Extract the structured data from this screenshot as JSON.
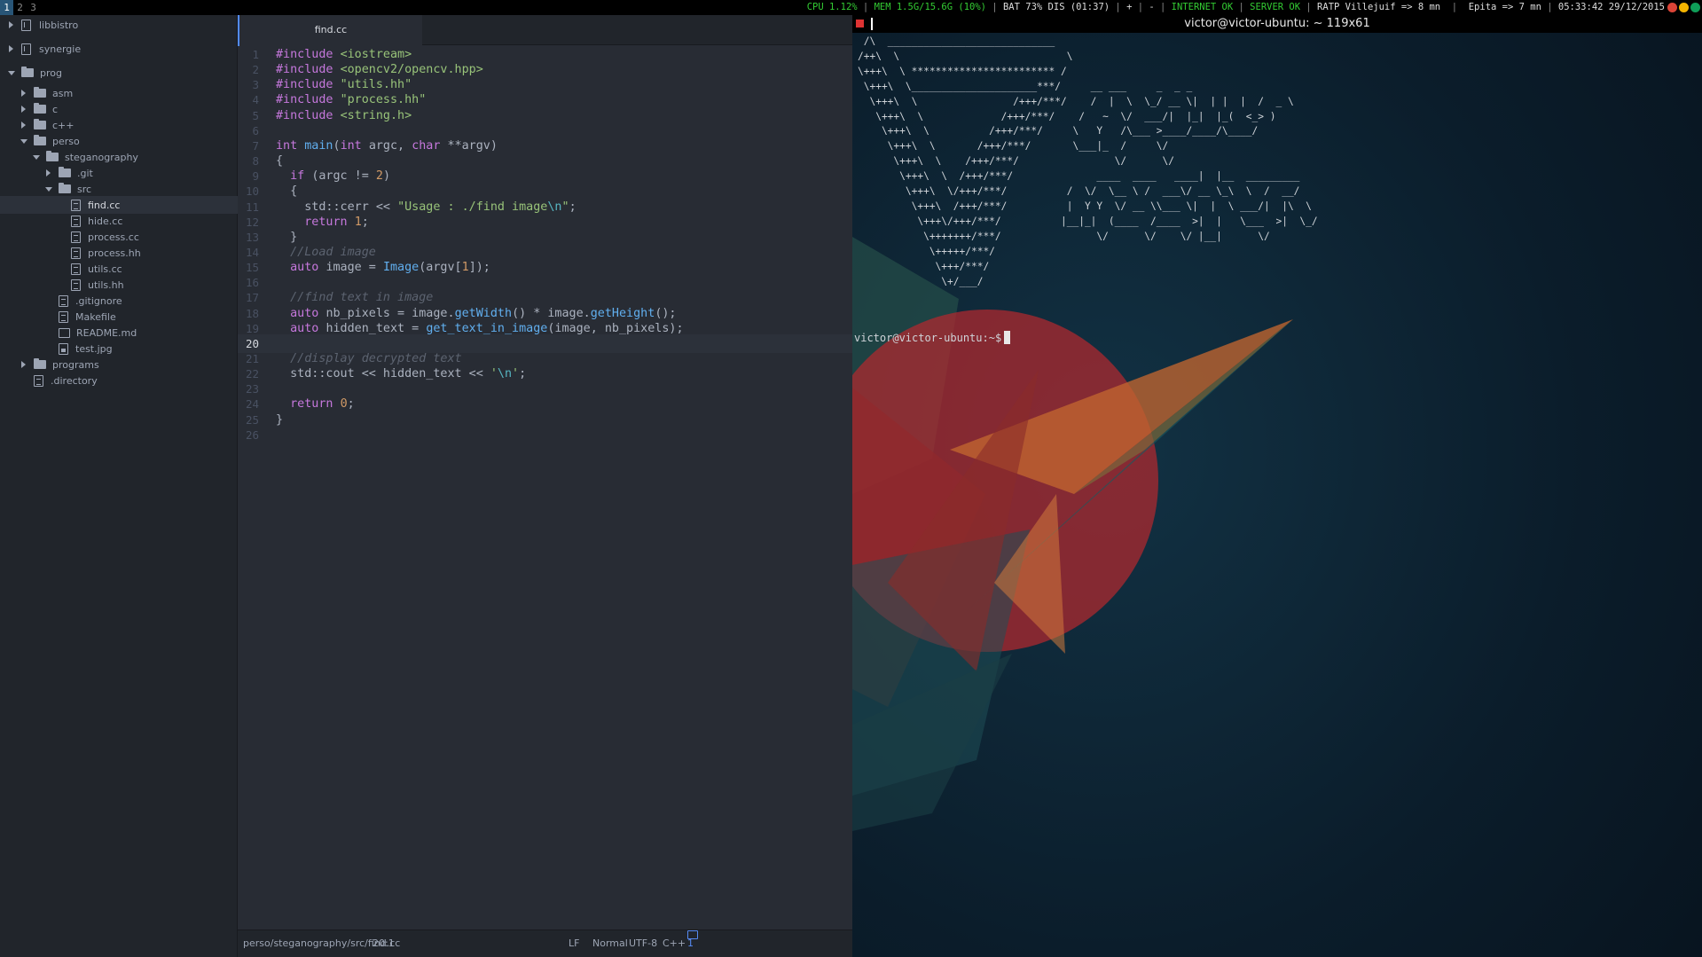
{
  "topbar": {
    "workspaces": [
      "1",
      "2",
      "3"
    ],
    "active_workspace": "1",
    "cpu": "CPU 1.12%",
    "mem": "MEM 1.5G/15.6G (10%)",
    "battery": "BAT 73% DIS (01:37)",
    "plus": "+",
    "dash": "-",
    "internet": "INTERNET OK",
    "server": "SERVER OK",
    "ratp": "RATP Villejuif => 8 mn",
    "epita": "Epita => 7 mn",
    "datetime": "05:33:42 29/12/2015"
  },
  "tree": [
    {
      "label": "libbistro",
      "icon": "repo-icon",
      "chevron": "right",
      "depth": 0
    },
    {
      "label": "synergie",
      "icon": "repo-icon",
      "chevron": "right",
      "depth": 0
    },
    {
      "label": "prog",
      "icon": "folder-icon",
      "chevron": "down",
      "depth": 0
    },
    {
      "label": "asm",
      "icon": "folder-icon",
      "chevron": "right",
      "depth": 1
    },
    {
      "label": "c",
      "icon": "folder-icon",
      "chevron": "right",
      "depth": 1
    },
    {
      "label": "c++",
      "icon": "folder-icon",
      "chevron": "right",
      "depth": 1
    },
    {
      "label": "perso",
      "icon": "folder-icon",
      "chevron": "down",
      "depth": 1
    },
    {
      "label": "steganography",
      "icon": "folder-icon",
      "chevron": "down",
      "depth": 2
    },
    {
      "label": ".git",
      "icon": "folder-icon",
      "chevron": "right",
      "depth": 3
    },
    {
      "label": "src",
      "icon": "folder-icon",
      "chevron": "down",
      "depth": 3
    },
    {
      "label": "find.cc",
      "icon": "file-icon",
      "chevron": "none",
      "depth": 4,
      "selected": true
    },
    {
      "label": "hide.cc",
      "icon": "file-icon",
      "chevron": "none",
      "depth": 4
    },
    {
      "label": "process.cc",
      "icon": "file-icon",
      "chevron": "none",
      "depth": 4
    },
    {
      "label": "process.hh",
      "icon": "file-icon",
      "chevron": "none",
      "depth": 4
    },
    {
      "label": "utils.cc",
      "icon": "file-icon",
      "chevron": "none",
      "depth": 4
    },
    {
      "label": "utils.hh",
      "icon": "file-icon",
      "chevron": "none",
      "depth": 4
    },
    {
      "label": ".gitignore",
      "icon": "file-icon",
      "chevron": "none",
      "depth": 3
    },
    {
      "label": "Makefile",
      "icon": "file-icon",
      "chevron": "none",
      "depth": 3
    },
    {
      "label": "README.md",
      "icon": "markdown-icon",
      "chevron": "none",
      "depth": 3
    },
    {
      "label": "test.jpg",
      "icon": "image-icon",
      "chevron": "none",
      "depth": 3
    },
    {
      "label": "programs",
      "icon": "folder-icon",
      "chevron": "right",
      "depth": 1
    },
    {
      "label": ".directory",
      "icon": "file-icon",
      "chevron": "none",
      "depth": 1
    }
  ],
  "editor": {
    "tab_title": "find.cc",
    "current_line": 20,
    "lines": [
      [
        [
          "k",
          "#include "
        ],
        [
          "s",
          "<iostream>"
        ]
      ],
      [
        [
          "k",
          "#include "
        ],
        [
          "s",
          "<opencv2/opencv.hpp>"
        ]
      ],
      [
        [
          "k",
          "#include "
        ],
        [
          "s",
          "\"utils.hh\""
        ]
      ],
      [
        [
          "k",
          "#include "
        ],
        [
          "s",
          "\"process.hh\""
        ]
      ],
      [
        [
          "k",
          "#include "
        ],
        [
          "s",
          "<string.h>"
        ]
      ],
      [],
      [
        [
          "t",
          "int "
        ],
        [
          "f",
          "main"
        ],
        [
          "p",
          "("
        ],
        [
          "t",
          "int "
        ],
        [
          "p",
          "argc, "
        ],
        [
          "t",
          "char "
        ],
        [
          "p",
          "**argv)"
        ]
      ],
      [
        [
          "p",
          "{"
        ]
      ],
      [
        [
          "p",
          "  "
        ],
        [
          "k",
          "if "
        ],
        [
          "p",
          "(argc != "
        ],
        [
          "n",
          "2"
        ],
        [
          "p",
          ")"
        ]
      ],
      [
        [
          "p",
          "  {"
        ]
      ],
      [
        [
          "p",
          "    std::cerr << "
        ],
        [
          "s",
          "\"Usage : ./find image"
        ],
        [
          "e",
          "\\n"
        ],
        [
          "s",
          "\""
        ],
        [
          "p",
          ";"
        ]
      ],
      [
        [
          "p",
          "    "
        ],
        [
          "k",
          "return "
        ],
        [
          "n",
          "1"
        ],
        [
          "p",
          ";"
        ]
      ],
      [
        [
          "p",
          "  }"
        ]
      ],
      [
        [
          "p",
          "  "
        ],
        [
          "c",
          "//Load image"
        ]
      ],
      [
        [
          "p",
          "  "
        ],
        [
          "k",
          "auto "
        ],
        [
          "p",
          "image = "
        ],
        [
          "f",
          "Image"
        ],
        [
          "p",
          "(argv["
        ],
        [
          "n",
          "1"
        ],
        [
          "p",
          "]);"
        ]
      ],
      [],
      [
        [
          "p",
          "  "
        ],
        [
          "c",
          "//find text in image"
        ]
      ],
      [
        [
          "p",
          "  "
        ],
        [
          "k",
          "auto "
        ],
        [
          "p",
          "nb_pixels = image."
        ],
        [
          "f",
          "getWidth"
        ],
        [
          "p",
          "() * image."
        ],
        [
          "f",
          "getHeight"
        ],
        [
          "p",
          "();"
        ]
      ],
      [
        [
          "p",
          "  "
        ],
        [
          "k",
          "auto "
        ],
        [
          "p",
          "hidden_text = "
        ],
        [
          "f",
          "get_text_in_image"
        ],
        [
          "p",
          "(image, nb_pixels);"
        ]
      ],
      [],
      [
        [
          "p",
          "  "
        ],
        [
          "c",
          "//display decrypted text"
        ]
      ],
      [
        [
          "p",
          "  std::cout << hidden_text << "
        ],
        [
          "s",
          "'"
        ],
        [
          "e",
          "\\n"
        ],
        [
          "s",
          "'"
        ],
        [
          "p",
          ";"
        ]
      ],
      [],
      [
        [
          "p",
          "  "
        ],
        [
          "k",
          "return "
        ],
        [
          "n",
          "0"
        ],
        [
          "p",
          ";"
        ]
      ],
      [
        [
          "p",
          "}"
        ]
      ],
      []
    ]
  },
  "editor_status": {
    "path": "perso/steganography/src/find.cc",
    "cursor": "20:1",
    "line_ending": "LF",
    "mode": "Normal",
    "encoding": "UTF-8",
    "grammar": "C++",
    "updates": "1 update"
  },
  "terminal": {
    "title": "victor@victor-ubuntu: ~ 119x61",
    "ascii_art": " /\\  ____________________________\n/++\\  \\                            \\\n\\+++\\  \\ ************************ /\n \\+++\\  \\_____________________***/     __ ___     _  _ _\n  \\+++\\  \\                /+++/***/    /  |  \\  \\_/ __ \\|  | |  |  /  _ \\\n   \\+++\\  \\             /+++/***/    /   ~  \\/  ___/|  |_|  |_(  <_> )\n    \\+++\\  \\          /+++/***/     \\   Y   /\\___ >____/____/\\____/\n     \\+++\\  \\       /+++/***/       \\___|_  /     \\/\n      \\+++\\  \\    /+++/***/                \\/      \\/\n       \\+++\\  \\  /+++/***/              ____  ____   ____|  |__  _________\n        \\+++\\  \\/+++/***/          /  \\/  \\__ \\ /  ___\\/ __ \\_\\  \\  /  __/\n         \\+++\\  /+++/***/          |  Y Y  \\/ __ \\\\___ \\|  |  \\ ___/|  |\\  \\\n          \\+++\\/+++/***/          |__|_|  (____  /____  >|  |   \\___  >|  \\_/\n           \\+++++++/***/                \\/      \\/    \\/ |__|      \\/\n            \\+++++/***/\n             \\+++/***/\n              \\+/___/",
    "prompt": "victor@victor-ubuntu:~$"
  },
  "colors": {
    "accent": "#528bff",
    "status_ok": "#33cc33",
    "terminal_bg": "#0b1d2b",
    "wallpaper_red": "#b3282e"
  }
}
